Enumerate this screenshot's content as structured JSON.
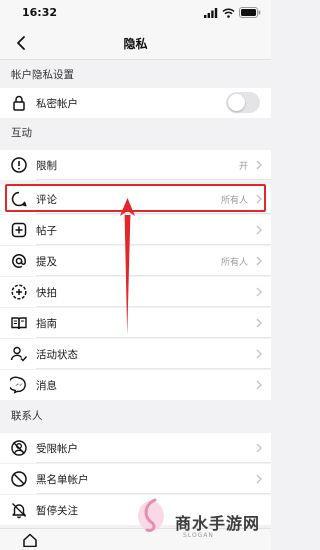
{
  "status_bar": {
    "time": "16:32"
  },
  "nav": {
    "title": "隐私"
  },
  "sections": {
    "account": "帐户隐私设置",
    "interaction": "互动",
    "contacts": "联系人"
  },
  "rows": {
    "private_account": {
      "label": "私密帐户",
      "toggle_on": false
    },
    "restrict": {
      "label": "限制",
      "value": "开"
    },
    "comments": {
      "label": "评论",
      "value": "所有人"
    },
    "posts": {
      "label": "帖子"
    },
    "mentions": {
      "label": "提及",
      "value": "所有人"
    },
    "snaps": {
      "label": "快拍"
    },
    "guides": {
      "label": "指南"
    },
    "activity_status": {
      "label": "活动状态"
    },
    "messages": {
      "label": "消息"
    },
    "restricted_accounts": {
      "label": "受限帐户"
    },
    "blocked_accounts": {
      "label": "黑名单帐户"
    },
    "muted_accounts": {
      "label": "暂停关注"
    }
  },
  "watermark": {
    "text": "商水手游网",
    "sub": "SLOGAN"
  },
  "colors": {
    "highlight": "#e3262a",
    "arrow": "#e3262a"
  }
}
